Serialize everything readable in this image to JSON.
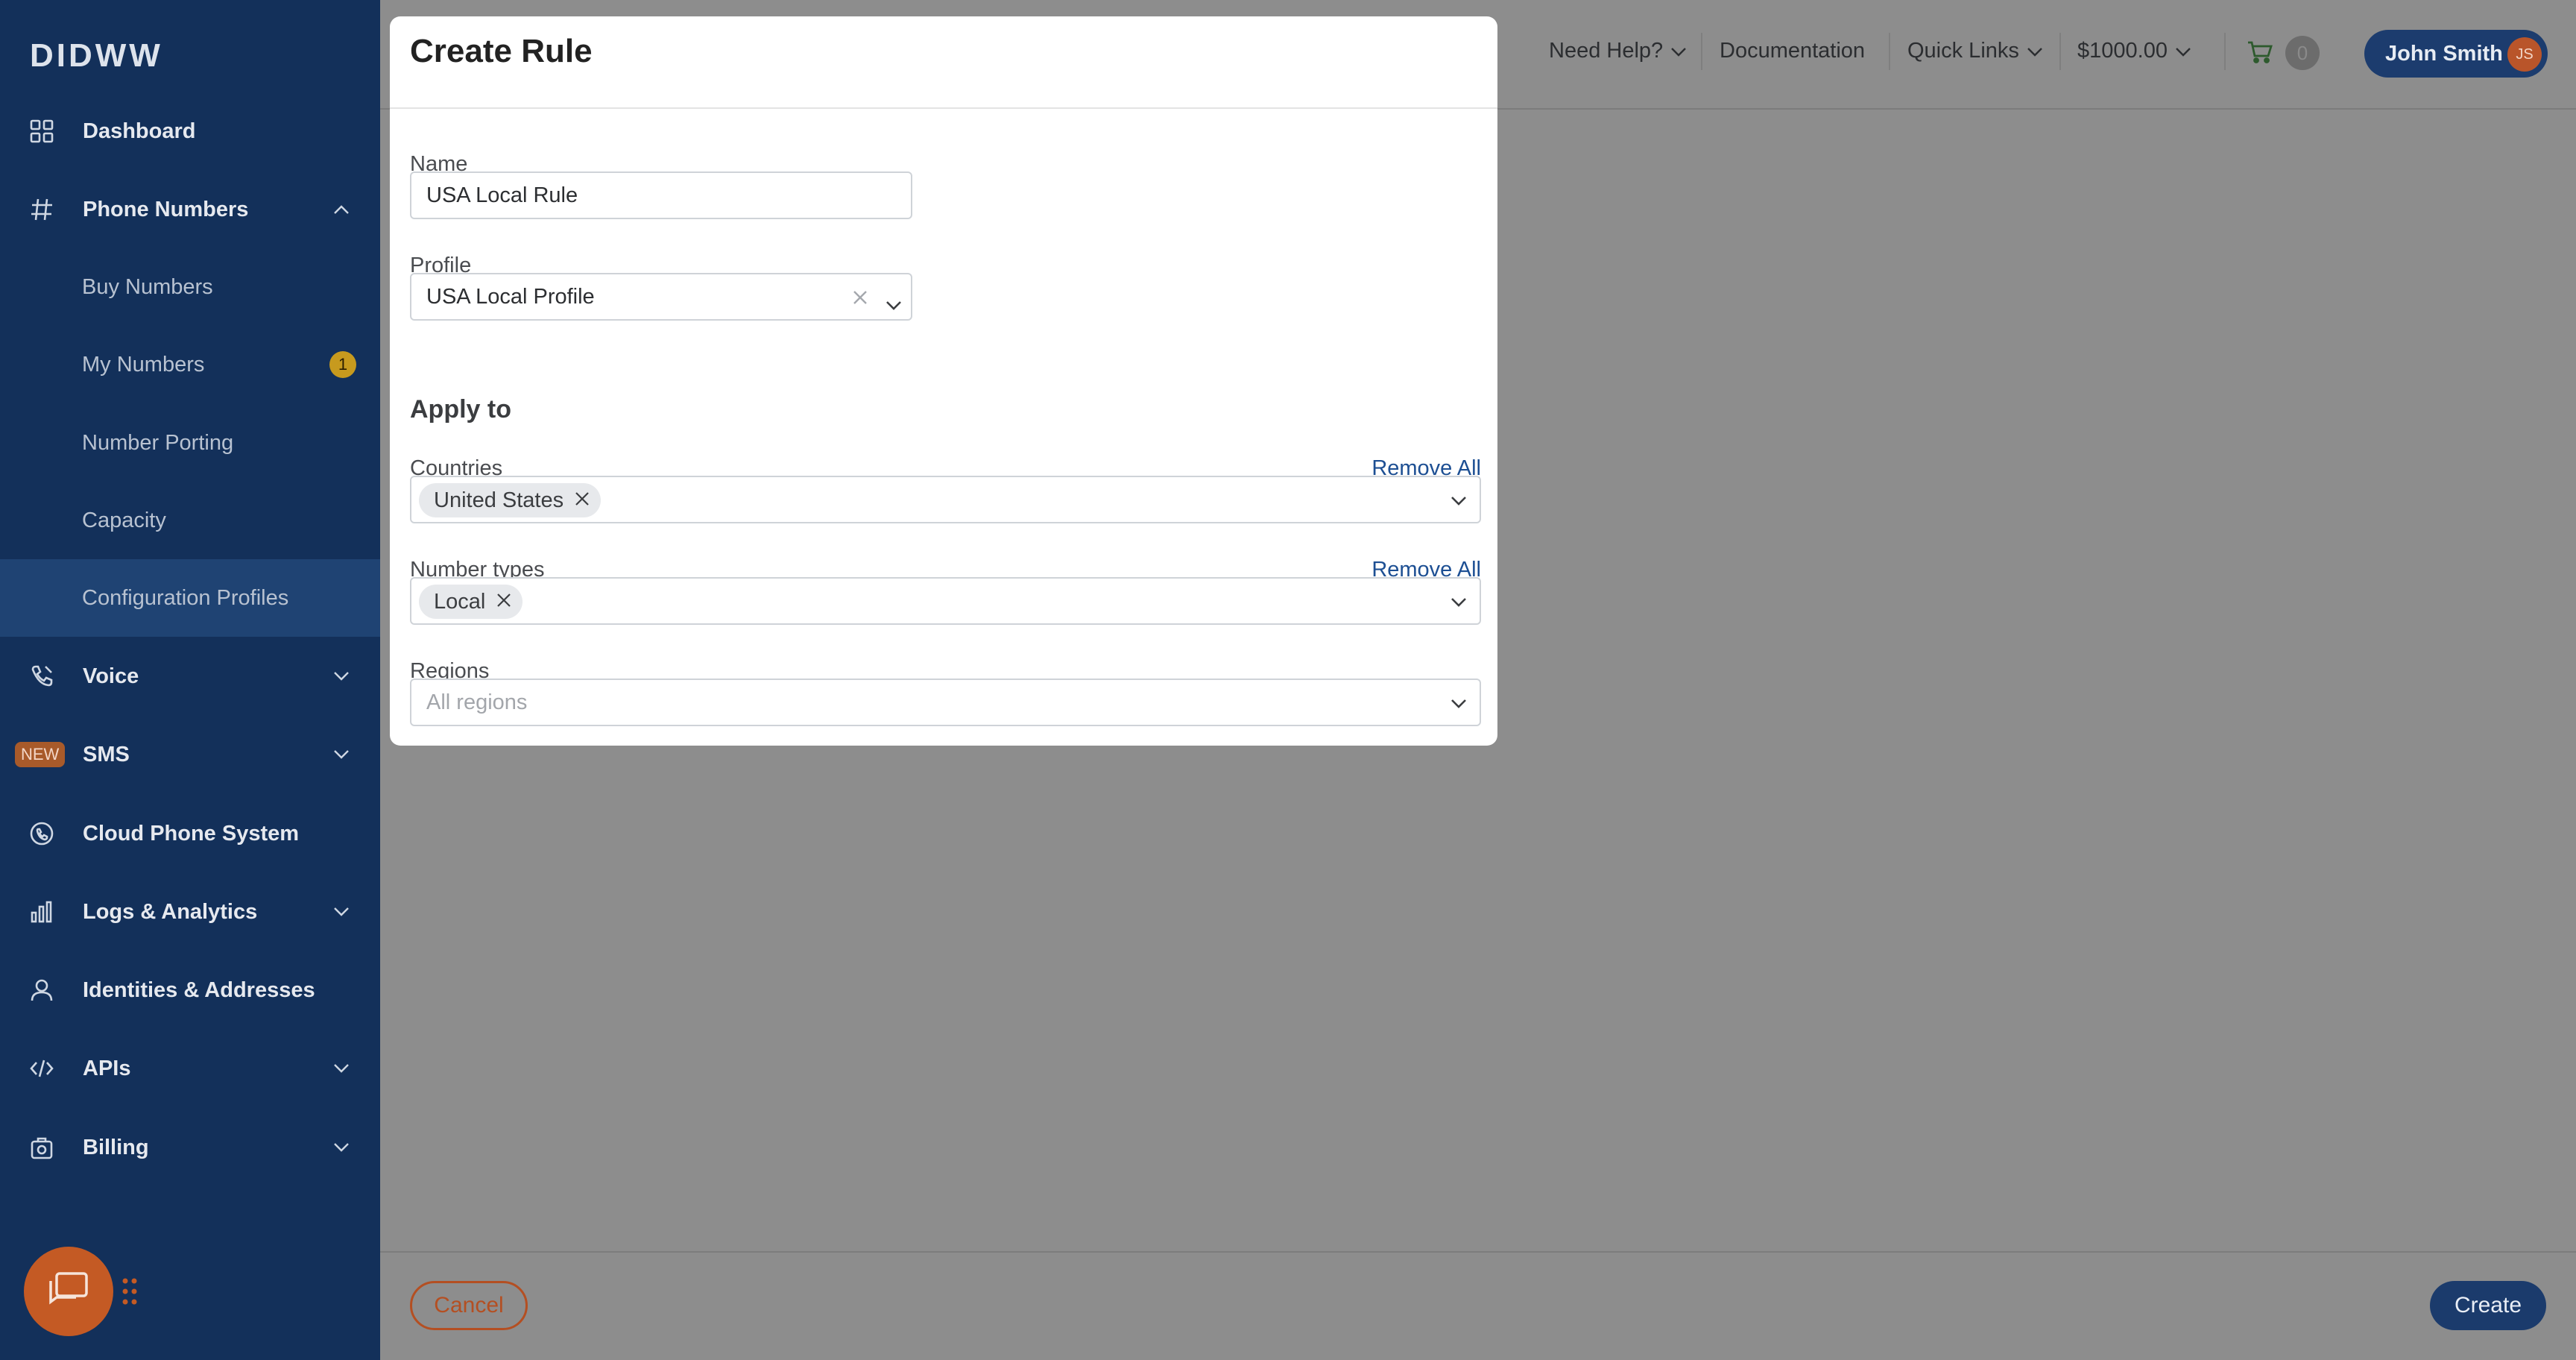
{
  "sidebar": {
    "logo": "DIDWW",
    "items": [
      {
        "label": "Dashboard"
      },
      {
        "label": "Phone Numbers"
      },
      {
        "label": "Voice"
      },
      {
        "label": "SMS",
        "badge": "NEW"
      },
      {
        "label": "Cloud Phone System"
      },
      {
        "label": "Logs & Analytics"
      },
      {
        "label": "Identities & Addresses"
      },
      {
        "label": "APIs"
      },
      {
        "label": "Billing"
      }
    ],
    "sub_items": [
      {
        "label": "Buy Numbers"
      },
      {
        "label": "My Numbers",
        "count": "1"
      },
      {
        "label": "Number Porting"
      },
      {
        "label": "Capacity"
      },
      {
        "label": "Configuration Profiles"
      }
    ]
  },
  "topbar": {
    "need_help": "Need Help?",
    "documentation": "Documentation",
    "quick_links": "Quick Links",
    "balance": "$1000.00",
    "cart_count": "0",
    "user_name": "John Smith",
    "user_initials": "JS"
  },
  "modal": {
    "title": "Create Rule",
    "name_label": "Name",
    "name_value": "USA Local Rule",
    "profile_label": "Profile",
    "profile_value": "USA Local Profile",
    "apply_to": "Apply to",
    "countries_label": "Countries",
    "countries_remove_all": "Remove All",
    "countries_tags": [
      "United States"
    ],
    "number_types_label": "Number types",
    "number_types_remove_all": "Remove All",
    "number_types_tags": [
      "Local"
    ],
    "regions_label": "Regions",
    "regions_placeholder": "All regions"
  },
  "footer": {
    "cancel": "Cancel",
    "create": "Create"
  },
  "colors": {
    "sidebar_bg": "#13305a",
    "accent_orange": "#b44f22",
    "primary_blue": "#1b3b6c",
    "link_blue": "#1d4f93"
  }
}
